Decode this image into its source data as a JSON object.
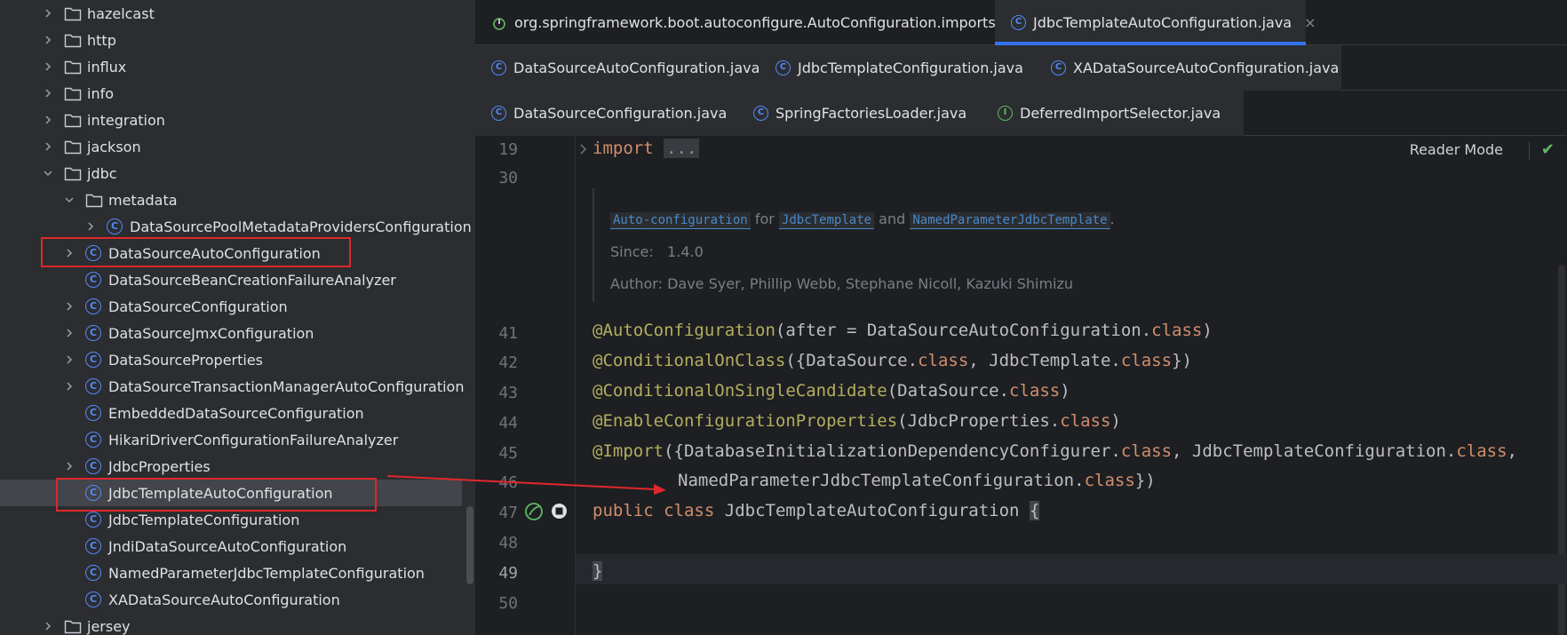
{
  "tree": {
    "rows": [
      {
        "label": "hazelcast",
        "kind": "folder",
        "depth": 0,
        "chevron": "right"
      },
      {
        "label": "http",
        "kind": "folder",
        "depth": 0,
        "chevron": "right"
      },
      {
        "label": "influx",
        "kind": "folder",
        "depth": 0,
        "chevron": "right"
      },
      {
        "label": "info",
        "kind": "folder",
        "depth": 0,
        "chevron": "right"
      },
      {
        "label": "integration",
        "kind": "folder",
        "depth": 0,
        "chevron": "right"
      },
      {
        "label": "jackson",
        "kind": "folder",
        "depth": 0,
        "chevron": "right"
      },
      {
        "label": "jdbc",
        "kind": "folder",
        "depth": 0,
        "chevron": "down"
      },
      {
        "label": "metadata",
        "kind": "folder",
        "depth": 1,
        "chevron": "down"
      },
      {
        "label": "DataSourcePoolMetadataProvidersConfiguration",
        "kind": "class",
        "depth": 2,
        "chevron": "right"
      },
      {
        "label": "DataSourceAutoConfiguration",
        "kind": "class",
        "depth": 1,
        "chevron": "right"
      },
      {
        "label": "DataSourceBeanCreationFailureAnalyzer",
        "kind": "class",
        "depth": 1,
        "chevron": ""
      },
      {
        "label": "DataSourceConfiguration",
        "kind": "class",
        "depth": 1,
        "chevron": "right"
      },
      {
        "label": "DataSourceJmxConfiguration",
        "kind": "class",
        "depth": 1,
        "chevron": "right"
      },
      {
        "label": "DataSourceProperties",
        "kind": "class",
        "depth": 1,
        "chevron": "right"
      },
      {
        "label": "DataSourceTransactionManagerAutoConfiguration",
        "kind": "class",
        "depth": 1,
        "chevron": "right"
      },
      {
        "label": "EmbeddedDataSourceConfiguration",
        "kind": "class",
        "depth": 1,
        "chevron": ""
      },
      {
        "label": "HikariDriverConfigurationFailureAnalyzer",
        "kind": "class",
        "depth": 1,
        "chevron": ""
      },
      {
        "label": "JdbcProperties",
        "kind": "class",
        "depth": 1,
        "chevron": "right"
      },
      {
        "label": "JdbcTemplateAutoConfiguration",
        "kind": "class",
        "depth": 1,
        "chevron": "",
        "selected": true
      },
      {
        "label": "JdbcTemplateConfiguration",
        "kind": "class",
        "depth": 1,
        "chevron": ""
      },
      {
        "label": "JndiDataSourceAutoConfiguration",
        "kind": "class",
        "depth": 1,
        "chevron": ""
      },
      {
        "label": "NamedParameterJdbcTemplateConfiguration",
        "kind": "class",
        "depth": 1,
        "chevron": ""
      },
      {
        "label": "XADataSourceAutoConfiguration",
        "kind": "class",
        "depth": 1,
        "chevron": ""
      },
      {
        "label": "jersey",
        "kind": "folder",
        "depth": 0,
        "chevron": "right"
      }
    ],
    "class_icon_letter": "C"
  },
  "tabs": {
    "row1": [
      {
        "label": "org.springframework.boot.autoconfigure.AutoConfiguration.imports",
        "icon": "imports-file-icon"
      },
      {
        "label": "JdbcTemplateAutoConfiguration.java",
        "icon": "class-icon",
        "active": true,
        "close": "×"
      }
    ],
    "row2": [
      {
        "label": "DataSourceAutoConfiguration.java",
        "icon": "class-icon"
      },
      {
        "label": "JdbcTemplateConfiguration.java",
        "icon": "class-icon"
      },
      {
        "label": "XADataSourceAutoConfiguration.java",
        "icon": "class-icon"
      }
    ],
    "row3": [
      {
        "label": "DataSourceConfiguration.java",
        "icon": "class-icon"
      },
      {
        "label": "SpringFactoriesLoader.java",
        "icon": "class-icon"
      },
      {
        "label": "DeferredImportSelector.java",
        "icon": "interface-icon",
        "letter": "I"
      }
    ]
  },
  "editor": {
    "reader_mode": "Reader Mode",
    "line_numbers": [
      "19",
      "30",
      "41",
      "42",
      "43",
      "44",
      "45",
      "46",
      "47",
      "48",
      "49",
      "50"
    ],
    "import_keyword": "import",
    "import_dots": "...",
    "doc": {
      "link1": "Auto-configuration",
      "for_text": "for",
      "link2": "JdbcTemplate",
      "and_text": "and",
      "link3": "NamedParameterJdbcTemplate",
      "period": ".",
      "since_label": "Since:",
      "since_value": "1.4.0",
      "author_label": "Author:",
      "author_value": "Dave Syer, Phillip Webb, Stephane Nicoll, Kazuki Shimizu"
    },
    "code": {
      "l41_ann": "@AutoConfiguration",
      "l41_rest": "(after = DataSourceAutoConfiguration.",
      "l41_kw": "class",
      "l41_end": ")",
      "l42_ann": "@ConditionalOnClass",
      "l42_a": "({DataSource.",
      "l42_kw1": "class",
      "l42_b": ", JdbcTemplate.",
      "l42_kw2": "class",
      "l42_end": "})",
      "l43_ann": "@ConditionalOnSingleCandidate",
      "l43_a": "(DataSource.",
      "l43_kw": "class",
      "l43_end": ")",
      "l44_ann": "@EnableConfigurationProperties",
      "l44_a": "(JdbcProperties.",
      "l44_kw": "class",
      "l44_end": ")",
      "l45_ann": "@Import",
      "l45_a": "({DatabaseInitializationDependencyConfigurer.",
      "l45_kw1": "class",
      "l45_b": ", JdbcTemplateConfiguration.",
      "l45_kw2": "class",
      "l45_end": ",",
      "l46_a": "NamedParameterJdbcTemplateConfiguration.",
      "l46_kw": "class",
      "l46_end": "})",
      "l47_kw1": "public",
      "l47_kw2": "class",
      "l47_name": "JdbcTemplateAutoConfiguration",
      "l47_brace": "{",
      "l49_brace": "}"
    }
  },
  "colors": {
    "accent": "#3574f0",
    "highlight_box": "#e0272b",
    "keyword": "#cf8e6d",
    "annotation": "#b3ae60"
  }
}
